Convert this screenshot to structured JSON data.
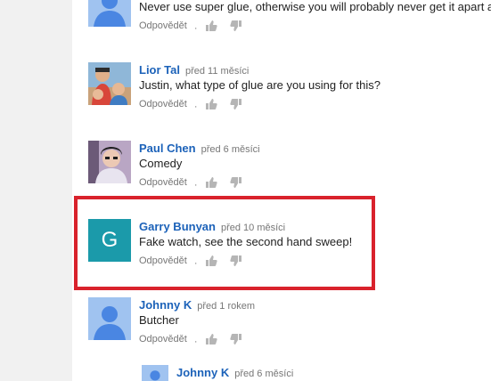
{
  "colors": {
    "page_bg": "#f1f1f1",
    "author_link": "#1c62b9",
    "highlight_border": "#d9222c",
    "letter_avatar": "#1b9aaa",
    "default_avatar": "#a0c3f0"
  },
  "comments": [
    {
      "author": "",
      "time": "",
      "text": "Never use super glue, otherwise you will probably never get it apart a",
      "reply": "Odpovědět",
      "avatar": "default-avatar-icon"
    },
    {
      "author": "Lior Tal",
      "time": "před 11 měsíci",
      "text": "Justin, what type of glue are you using for this?",
      "reply": "Odpovědět",
      "avatar": "photo"
    },
    {
      "author": "Paul Chen",
      "time": "před 6 měsíci",
      "text": "Comedy",
      "reply": "Odpovědět",
      "avatar": "photo"
    },
    {
      "author": "Garry Bunyan",
      "time": "před 10 měsíci",
      "text": "Fake watch, see the second hand sweep!",
      "reply": "Odpovědět",
      "avatar_letter": "G"
    },
    {
      "author": "Johnny K",
      "time": "před 1 rokem",
      "text": "Butcher",
      "reply": "Odpovědět",
      "avatar": "default-avatar-icon"
    },
    {
      "author": "Johnny K",
      "time": "před 6 měsíci",
      "avatar": "default-avatar-icon"
    }
  ],
  "action_icons": [
    "thumb-up-icon",
    "thumb-down-icon"
  ]
}
